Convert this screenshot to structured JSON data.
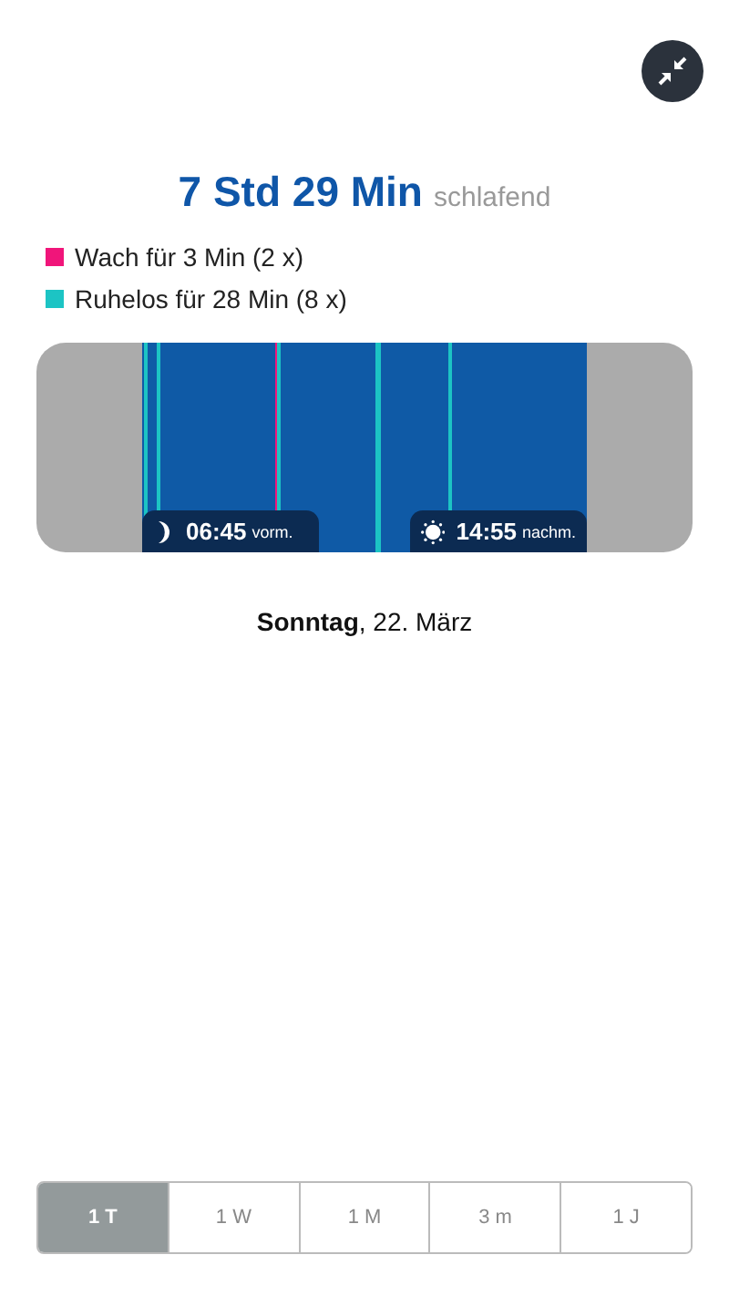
{
  "summary": {
    "duration": "7 Std 29 Min",
    "label": "schlafend"
  },
  "legend": [
    {
      "label": "Wach für 3 Min (2 x)",
      "color": "#f0157a"
    },
    {
      "label": "Ruhelos für 28 Min (8 x)",
      "color": "#1cc4c4"
    }
  ],
  "chart": {
    "start_time": "06:45",
    "start_suffix": "vorm.",
    "end_time": "14:55",
    "end_suffix": "nachm."
  },
  "date": {
    "weekday": "Sonntag",
    "rest": ", 22. März"
  },
  "tabs": [
    {
      "label": "1 T",
      "selected": true
    },
    {
      "label": "1 W",
      "selected": false
    },
    {
      "label": "1 M",
      "selected": false
    },
    {
      "label": "3 m",
      "selected": false
    },
    {
      "label": "1 J",
      "selected": false
    }
  ]
}
